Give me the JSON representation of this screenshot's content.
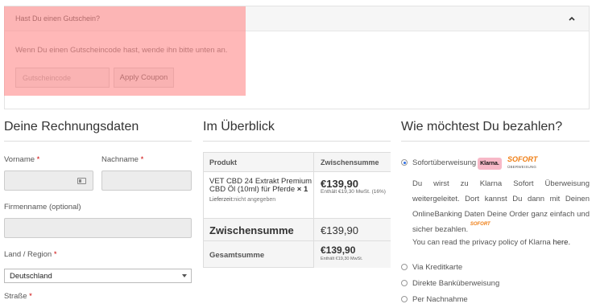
{
  "coupon": {
    "title": "Hast Du einen Gutschein?",
    "text": "Wenn Du einen Gutscheincode hast, wende ihn bitte unten an.",
    "placeholder": "Gutscheincode",
    "apply_label": "Apply Coupon"
  },
  "billing": {
    "heading": "Deine Rechnungsdaten",
    "firstname_label": "Vorname",
    "lastname_label": "Nachname",
    "company_label": "Firmenname (optional)",
    "country_label": "Land / Region",
    "country_value": "Deutschland",
    "street_label": "Straße",
    "required_mark": "*"
  },
  "overview": {
    "heading": "Im Überblick",
    "col_product": "Produkt",
    "col_subtotal": "Zwischensumme",
    "product_name": "VET CBD 24 Extrakt Premium CBD Öl (10ml) für Pferde",
    "product_qty": "× 1",
    "delivery_label": "Lieferzeit:",
    "delivery_value": "nicht angegeben",
    "product_price": "€139,90",
    "product_tax": "Enthält €19,30 MwSt. (16%)",
    "subtotal_label": "Zwischensumme",
    "subtotal_value": "€139,90",
    "total_label": "Gesamtsumme",
    "total_value": "€139,90",
    "total_tax": "Enthält €19,30 MwSt."
  },
  "payment": {
    "heading": "Wie möchtest Du bezahlen?",
    "sofort_label": "Sofortüberweisung",
    "klarna_badge": "Klarna.",
    "sofort_logo": "SOFORT",
    "sofort_logo_sub": "ÜBERWEISUNG",
    "description": "Du wirst zu Klarna Sofort Überweisung weitergeleitet. Dort kannst Du dann mit Deinen OnlineBanking Daten Deine Order ganz einfach und sicher bezahlen.",
    "privacy_text": "You can read the privacy policy of Klarna",
    "privacy_link": "here.",
    "option_card": "Via Kreditkarte",
    "option_bank": "Direkte Banküberweisung",
    "option_cod": "Per Nachnahme"
  },
  "colors": {
    "overlay": "#ff8c8c",
    "accent": "#2b6ee6",
    "sofort_orange": "#ef7e14",
    "klarna_pink": "#f7b8c7"
  }
}
